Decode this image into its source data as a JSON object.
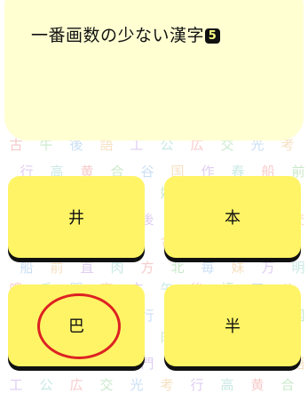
{
  "question": {
    "text": "一番画数の少ない漢字",
    "number": "5"
  },
  "answers": [
    {
      "kanji": "井"
    },
    {
      "kanji": "本"
    },
    {
      "kanji": "巴",
      "selected": true
    },
    {
      "kanji": "半"
    }
  ],
  "background": {
    "kanji": [
      "古",
      "午",
      "後",
      "語",
      "工",
      "公",
      "広",
      "交",
      "光",
      "考",
      "行",
      "高",
      "黄",
      "合",
      "谷",
      "国",
      "作",
      "春",
      "船",
      "前",
      "直",
      "肉",
      "方",
      "北",
      "毎",
      "妹",
      "万",
      "明",
      "鳴",
      "毛",
      "門",
      "夜"
    ],
    "colors": [
      "#f2a0a0",
      "#9fd6a0",
      "#a0c4ee",
      "#f0c890",
      "#c6a6e6",
      "#9fd8d0"
    ]
  },
  "colors": {
    "card": "#ffffd2",
    "button": "#fff466",
    "button_shadow": "#111111",
    "selection": "#dd2222"
  }
}
